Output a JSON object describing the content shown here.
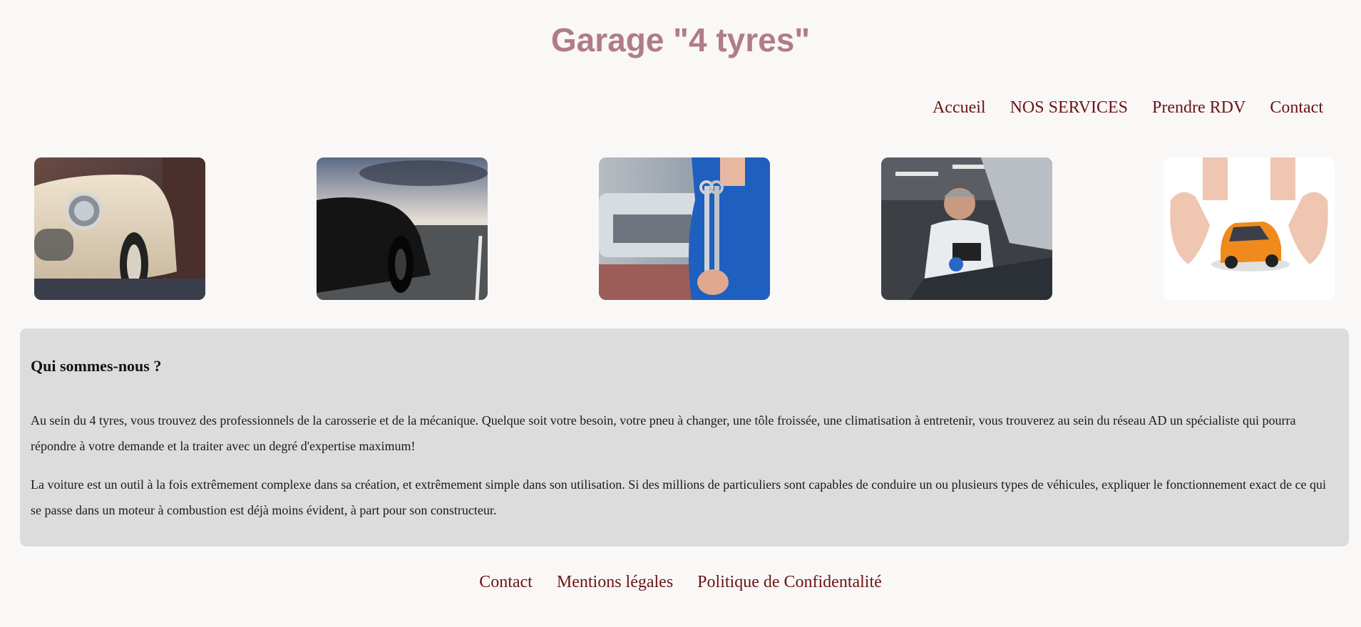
{
  "header": {
    "title": "Garage \"4 tyres\""
  },
  "nav": {
    "items": [
      "Accueil",
      "NOS SERVICES",
      "Prendre RDV",
      "Contact"
    ]
  },
  "gallery": {
    "images": [
      {
        "icon": "vintage-car-photo"
      },
      {
        "icon": "sports-car-photo"
      },
      {
        "icon": "mechanic-wrenches-photo"
      },
      {
        "icon": "mechanic-engine-photo"
      },
      {
        "icon": "car-insurance-hands-photo"
      }
    ]
  },
  "about": {
    "heading": "Qui sommes-nous ?",
    "paragraphs": [
      "Au sein du 4 tyres, vous trouvez des professionnels de la carosserie et de la mécanique. Quelque soit votre besoin, votre pneu à changer, une tôle froissée, une climatisation à entretenir, vous trouverez au sein du réseau AD un spécialiste qui pourra répondre à votre demande et la traiter avec un degré d'expertise maximum!",
      "La voiture est un outil à la fois extrêmement complexe dans sa création, et extrêmement simple dans son utilisation. Si des millions de particuliers sont capables de conduire un ou plusieurs types de véhicules, expliquer le fonctionnement exact de ce qui se passe dans un moteur à combustion est déjà moins évident, à part pour son constructeur."
    ]
  },
  "footer": {
    "items": [
      "Contact",
      "Mentions légales",
      "Politique de Confidentalité"
    ]
  },
  "colors": {
    "title": "#b07c86",
    "links": "#6a1414",
    "background": "#faf7f7",
    "panel": "#dcdcdc"
  }
}
